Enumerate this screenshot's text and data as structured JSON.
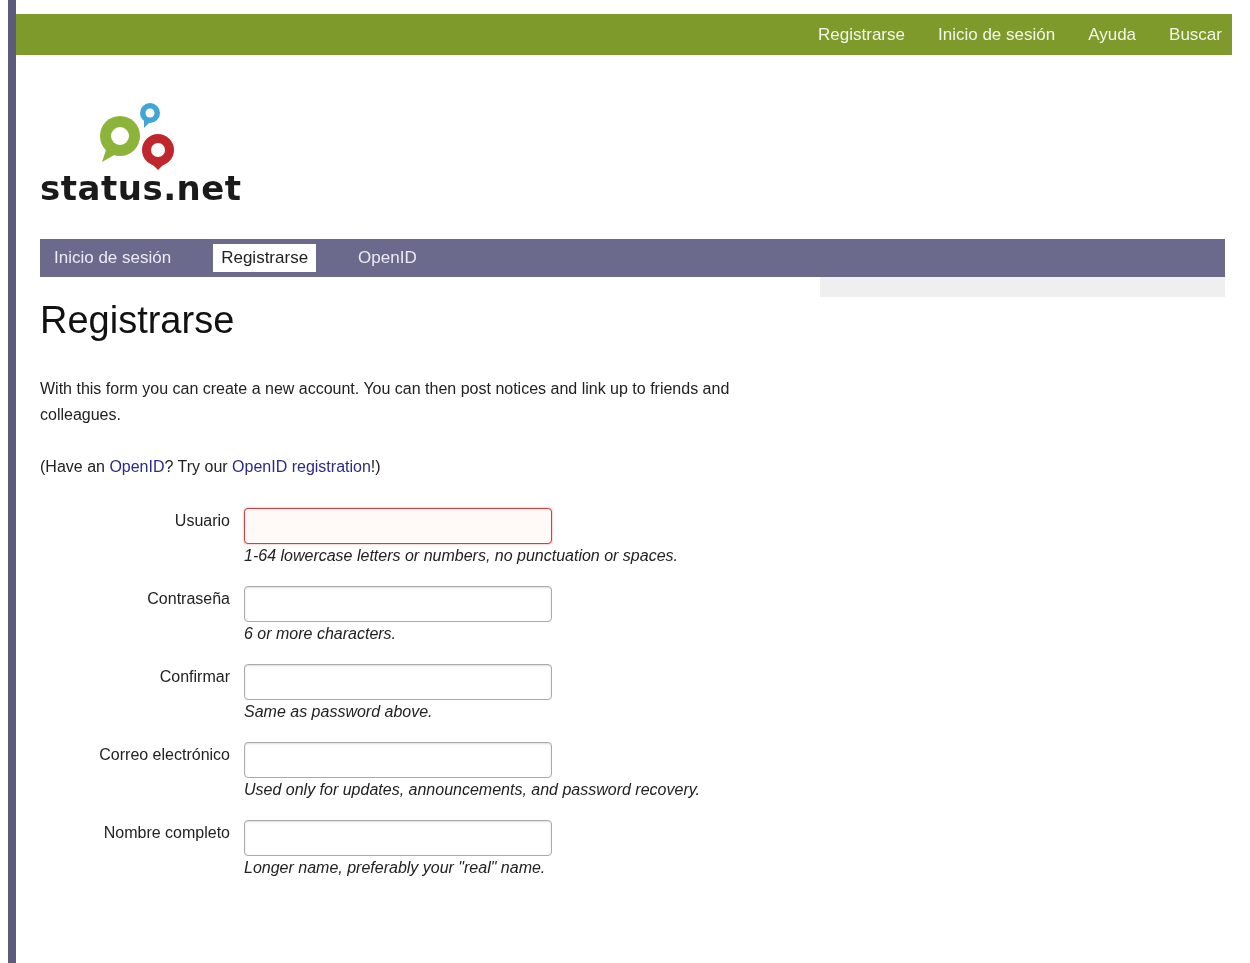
{
  "top_nav": [
    {
      "label": "Registrarse"
    },
    {
      "label": "Inicio de sesión"
    },
    {
      "label": "Ayuda"
    },
    {
      "label": "Buscar"
    }
  ],
  "logo": {
    "text": "status.net"
  },
  "tabs": [
    {
      "label": "Inicio de sesión",
      "selected": false
    },
    {
      "label": "Registrarse",
      "selected": true
    },
    {
      "label": "OpenID",
      "selected": false
    }
  ],
  "heading": "Registrarse",
  "intro": "With this form you can create a new account. You can then post notices and link up to friends and colleagues.",
  "openid_note": [
    {
      "kind": "text",
      "text": "(Have an "
    },
    {
      "kind": "link",
      "text": "OpenID"
    },
    {
      "kind": "text",
      "text": "? Try our "
    },
    {
      "kind": "link",
      "text": "OpenID registration"
    },
    {
      "kind": "text",
      "text": "!)"
    }
  ],
  "fields": [
    {
      "label": "Usuario",
      "hint": "1-64 lowercase letters or numbers, no punctuation or spaces.",
      "focused": true
    },
    {
      "label": "Contraseña",
      "hint": "6 or more characters.",
      "focused": false
    },
    {
      "label": "Confirmar",
      "hint": "Same as password above.",
      "focused": false
    },
    {
      "label": "Correo electrónico",
      "hint": "Used only for updates, announcements, and password recovery.",
      "focused": false
    },
    {
      "label": "Nombre completo",
      "hint": "Longer name, preferably your \"real\" name.",
      "focused": false
    }
  ]
}
